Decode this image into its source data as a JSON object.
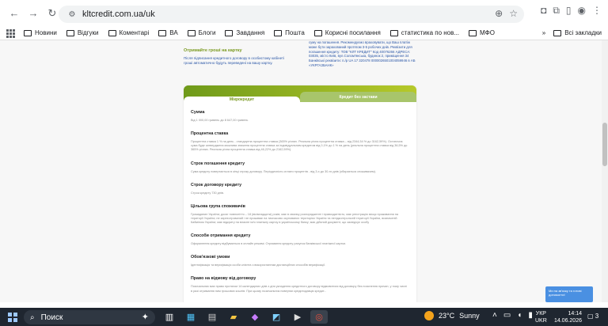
{
  "browser": {
    "url": "kltcredit.com.ua/uk",
    "nav_icons": [
      "back-arrow-icon",
      "forward-arrow-icon",
      "reload-icon"
    ]
  },
  "bookmarks": [
    {
      "label": "Новини"
    },
    {
      "label": "Відгуки"
    },
    {
      "label": "Коментарі"
    },
    {
      "label": "ВА"
    },
    {
      "label": "Блоги"
    },
    {
      "label": "Завдання"
    },
    {
      "label": "Пошта"
    },
    {
      "label": "Корисні посилання"
    },
    {
      "label": "статистика по нов..."
    },
    {
      "label": "МФО"
    }
  ],
  "bookmarks_more": "»",
  "all_bookmarks": "Всі закладки",
  "intro": {
    "green_title": "Отримайте гроші на картку",
    "left_text": "Після підписання кредитного договору в особистому кабінеті гроші автоматично будуть переведені на вашу картку.",
    "right_text": "суму на погашення. Рекомендуємо враховувати, що Ваш платіж може бути зарахований протягом 3-5 робочих днів. Реквізити для погашення кредиту: ТОВ \"КЛТ КРЕДИТ\" Код 40076266 АДРЕСА: 03035, місто Київ, вул.Солом'янська, будинок 2, приміщення 34 Банківські реквізити: п./р UA 17 320478 0000026501004059946 в АБ «УКРГАЗБАНК»"
  },
  "card": {
    "tab_active": "Мікрокредит",
    "tab_inactive": "Кредит без застави",
    "sections": [
      {
        "title": "Сумма",
        "text": "Від 1 000,00 гривень до 8 647,00 гривень"
      },
      {
        "title": "Процентна ставка",
        "text": "Процентна ставка 1 % на день - стандартна процентна ставка (365% річних. Реальна річна процентна ставка – від 2344,54 % до 3162,59%). Остаточна сума буде затверджена можлива знижена процентна ставка за індивідуальним кредитом від 0,1% до 1 % на день (реальна процентна ставка від 36,5% до 365% річних. Реальна річна процентна ставка від 46,22% до 2162,59%)."
      },
      {
        "title": "Строк погашення кредиту",
        "text": "Сума кредиту повертається в кінці строку договору. Періодичність сплати процентів - від 3-х до 30-ти днів (обирається споживачем)."
      },
      {
        "title": "Строк договору кредиту",
        "text": "Строк кредиту 730 днів."
      },
      {
        "title": "Цільова група споживачів",
        "text": "Громадянин України; досяг повноліття – 18 (вісімнадцяти) років; має в своєму розпорядженні і правоздатність; має реєстрацію місця проживання на території України; не зареєстрований і не проживає на тимчасово окупованих територіях України та непідконтрольній території України, визначеній Кабміном України; має відкриту на власне ім'я платіжну картку в українському банку; має дійсний документ, що засвідчує особу"
      },
      {
        "title": "Способи отримання кредиту",
        "text": "Оформлення кредиту відбувається в онлайн режимі. Отримання кредиту рахунок банківської платіжної картки."
      },
      {
        "title": "Обов'язкові умови",
        "text": "Ідентифікація та верифікація особи клієнта з використанням дистанційних способів верифікації."
      },
      {
        "title": "Право на відмову від договору",
        "text": "Позичальник має право протягом 14 календарних днів з дня укладення кредитного договору відмовитися від договору без пояснення причин, у тому числі в разі отримання ним грошових коштів. При цьому позичальник повертає кредитодавцю кредит..."
      }
    ]
  },
  "chat_widget": {
    "text": "Ми на зв'язку та готові допомогти!"
  },
  "taskbar": {
    "search_label": "Поиск",
    "weather_temp": "23°C",
    "weather_desc": "Sunny",
    "lang_top": "УКР",
    "lang_bottom": "UKR",
    "time": "14:14",
    "date": "14.06.2026",
    "notification_count": "3"
  }
}
